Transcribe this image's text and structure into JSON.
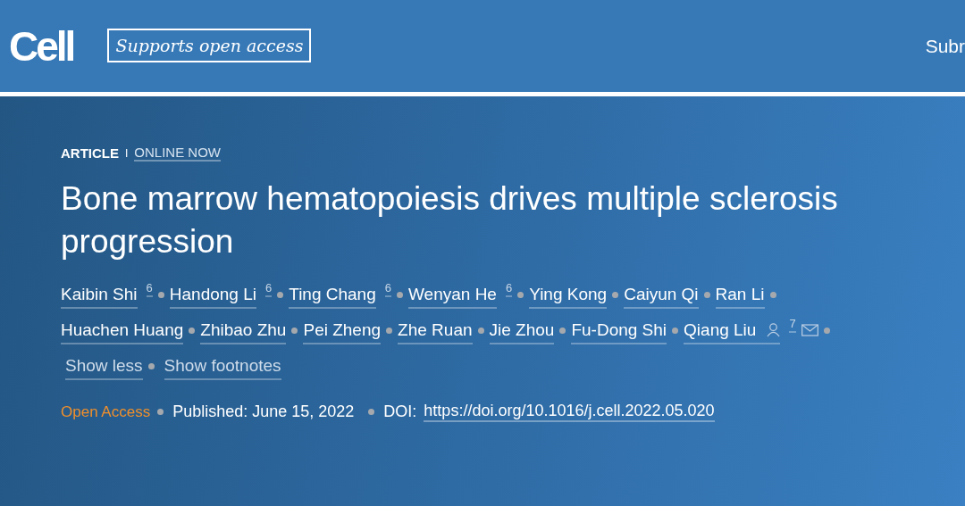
{
  "header": {
    "logo": "Cell",
    "badge": "Supports open access",
    "nav_item": "Subr"
  },
  "article": {
    "type": "ARTICLE",
    "separator": "I",
    "status": "ONLINE NOW",
    "title": "Bone marrow hematopoiesis drives multiple sclerosis progression",
    "authors": [
      {
        "name": "Kaibin Shi",
        "note": "6",
        "contact": false
      },
      {
        "name": "Handong Li",
        "note": "6",
        "contact": false
      },
      {
        "name": "Ting Chang",
        "note": "6",
        "contact": false
      },
      {
        "name": "Wenyan He",
        "note": "6",
        "contact": false
      },
      {
        "name": "Ying Kong",
        "contact": false
      },
      {
        "name": "Caiyun Qi",
        "contact": false
      },
      {
        "name": "Ran Li",
        "contact": false
      },
      {
        "name": "Huachen Huang",
        "contact": false
      },
      {
        "name": "Zhibao Zhu",
        "contact": false
      },
      {
        "name": "Pei Zheng",
        "contact": false
      },
      {
        "name": "Zhe Ruan",
        "contact": false
      },
      {
        "name": "Jie Zhou",
        "contact": false
      },
      {
        "name": "Fu-Dong Shi",
        "contact": false
      },
      {
        "name": "Qiang Liu",
        "note": "7",
        "contact": true
      }
    ],
    "toggles": [
      "Show less",
      "Show footnotes"
    ],
    "access": "Open Access",
    "published": "Published: June 15, 2022",
    "doi_label": "DOI:",
    "doi": "https://doi.org/10.1016/j.cell.2022.05.020"
  }
}
